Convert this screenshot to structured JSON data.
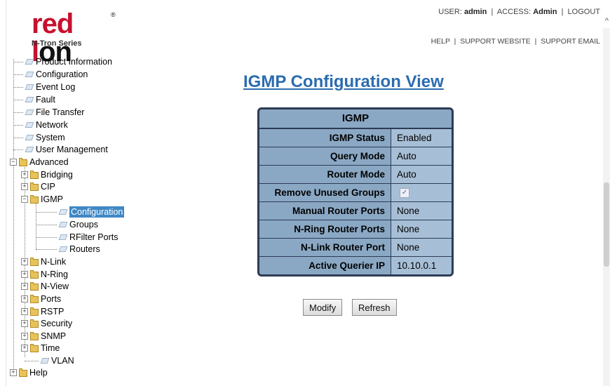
{
  "header": {
    "brand_red": "red l",
    "brand_dark": "on",
    "brand_reg": "®",
    "series": "N-Tron Series",
    "user_label": "USER:",
    "user": "admin",
    "access_label": "ACCESS:",
    "access": "Admin",
    "logout": "LOGOUT",
    "help": "HELP",
    "support_website": "SUPPORT WEBSITE",
    "support_email": "SUPPORT EMAIL"
  },
  "tree": {
    "product_information": "Product Information",
    "configuration": "Configuration",
    "event_log": "Event Log",
    "fault": "Fault",
    "file_transfer": "File Transfer",
    "network": "Network",
    "system": "System",
    "user_management": "User Management",
    "advanced": "Advanced",
    "bridging": "Bridging",
    "cip": "CIP",
    "igmp": "IGMP",
    "igmp_configuration": "Configuration",
    "igmp_groups": "Groups",
    "igmp_rfilter_ports": "RFilter Ports",
    "igmp_routers": "Routers",
    "nlink": "N-Link",
    "nring": "N-Ring",
    "nview": "N-View",
    "ports": "Ports",
    "rstp": "RSTP",
    "security": "Security",
    "snmp": "SNMP",
    "time": "Time",
    "vlan": "VLAN",
    "help": "Help"
  },
  "main": {
    "title": "IGMP Configuration View",
    "panel_title": "IGMP",
    "rows": [
      {
        "label": "IGMP Status",
        "value": "Enabled"
      },
      {
        "label": "Query Mode",
        "value": "Auto"
      },
      {
        "label": "Router Mode",
        "value": "Auto"
      },
      {
        "label": "Remove Unused Groups",
        "value": "✓"
      },
      {
        "label": "Manual Router Ports",
        "value": "None"
      },
      {
        "label": "N-Ring Router Ports",
        "value": "None"
      },
      {
        "label": "N-Link Router Port",
        "value": "None"
      },
      {
        "label": "Active Querier IP",
        "value": "10.10.0.1"
      }
    ],
    "modify_label": "Modify",
    "refresh_label": "Refresh"
  },
  "colors": {
    "title": "#2b6cb0",
    "panel_border": "#2d3b55",
    "label_bg": "#8aa8c4",
    "value_bg": "#a7bfd6",
    "selected_bg": "#3f88c5",
    "brand_red": "#c8102e"
  }
}
